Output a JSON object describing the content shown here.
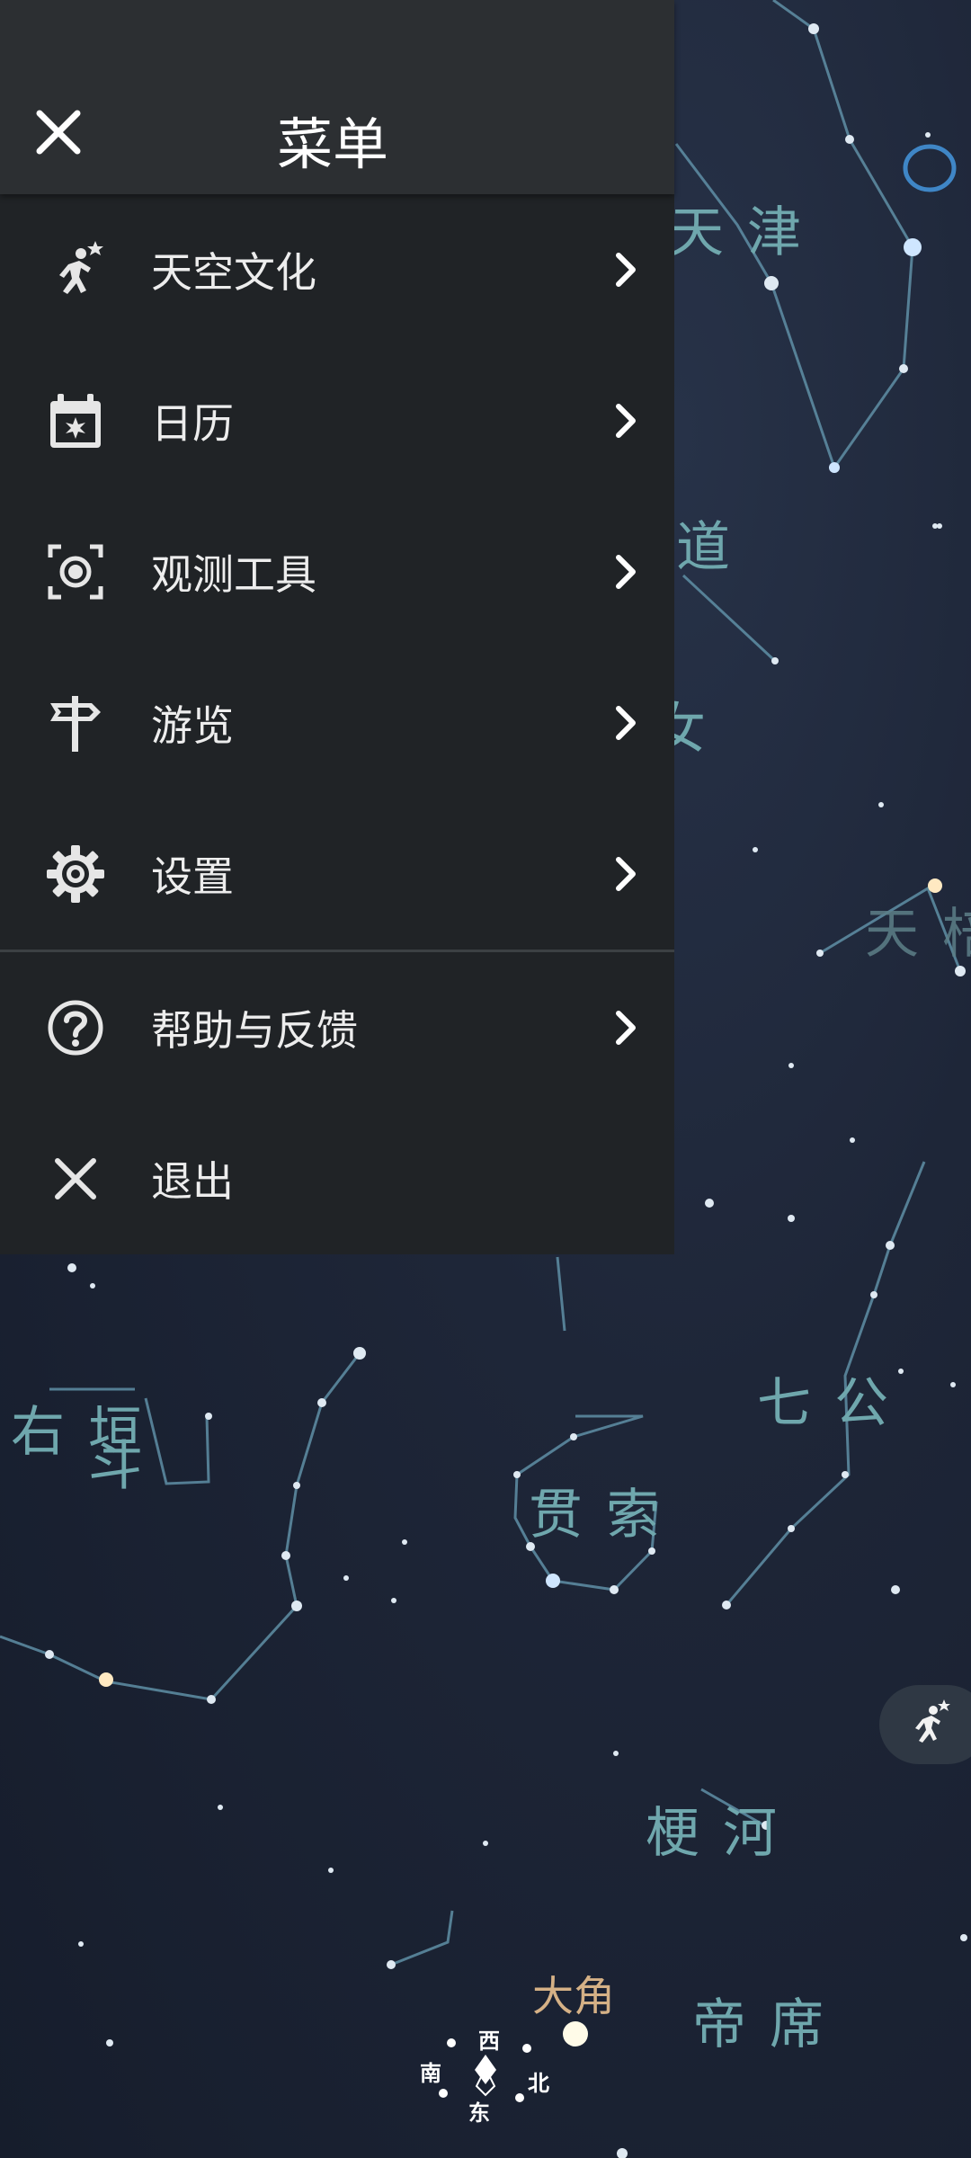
{
  "drawer": {
    "title": "菜单",
    "items": [
      {
        "label": "天空文化",
        "icon": "sky-culture-icon"
      },
      {
        "label": "日历",
        "icon": "calendar-icon"
      },
      {
        "label": "观测工具",
        "icon": "observation-tools-icon"
      },
      {
        "label": "游览",
        "icon": "signpost-icon"
      },
      {
        "label": "设置",
        "icon": "gear-icon"
      },
      {
        "label": "帮助与反馈",
        "icon": "help-icon"
      },
      {
        "label": "退出",
        "icon": "close-icon"
      }
    ]
  },
  "sky": {
    "constellations": [
      "天津",
      "道",
      "女",
      "天棓",
      "右垣",
      "斗",
      "七公",
      "贯索",
      "梗河",
      "帝席"
    ],
    "stars": [
      "大角"
    ],
    "compass": {
      "west": "西",
      "south": "南",
      "north": "北",
      "east": "东"
    }
  },
  "colors": {
    "drawer_bg": "#202326",
    "header_bg": "#2c2f32",
    "constellation_label": "#6fa7ad",
    "star_label": "#d5b186"
  }
}
